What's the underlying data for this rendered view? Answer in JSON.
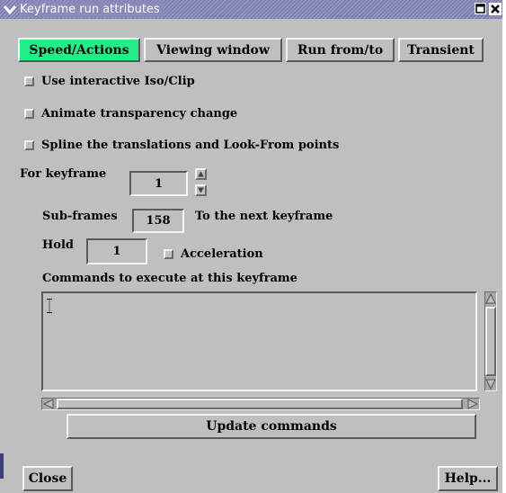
{
  "window": {
    "title": "Keyframe run attributes",
    "menu_icon": "chevron-down-icon",
    "maximize_icon": "maximize-icon",
    "close_icon": "close-icon"
  },
  "tabs": [
    {
      "label": "Speed/Actions",
      "active": true
    },
    {
      "label": "Viewing window",
      "active": false
    },
    {
      "label": "Run from/to",
      "active": false
    },
    {
      "label": "Transient",
      "active": false
    }
  ],
  "options": {
    "interactive_iso_clip": "Use interactive Iso/Clip",
    "animate_transparency": "Animate transparency change",
    "spline_translations": "Spline the translations and Look-From points"
  },
  "keyframe": {
    "label": "For keyframe",
    "value": "1",
    "up_icon": "arrow-up-icon",
    "down_icon": "arrow-down-icon"
  },
  "subframes": {
    "label": "Sub-frames",
    "value": "158",
    "suffix": "To the next keyframe"
  },
  "hold": {
    "label": "Hold",
    "value": "1",
    "acceleration_label": "Acceleration"
  },
  "commands": {
    "label": "Commands to execute at this keyframe",
    "text": "",
    "update_label": "Update commands"
  },
  "footer": {
    "close_label": "Close",
    "help_label": "Help..."
  },
  "colors": {
    "panel_bg": "#bfbfbf",
    "active_tab": "#22ee88",
    "titlebar": "#8a8aba"
  }
}
